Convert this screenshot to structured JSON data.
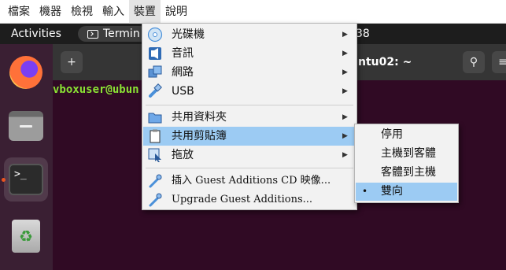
{
  "vbox_menubar": {
    "items": [
      {
        "label": "檔案",
        "active": false
      },
      {
        "label": "機器",
        "active": false
      },
      {
        "label": "檢視",
        "active": false
      },
      {
        "label": "輸入",
        "active": false
      },
      {
        "label": "裝置",
        "active": true
      },
      {
        "label": "說明",
        "active": false
      }
    ]
  },
  "ubuntu_topbar": {
    "activities": "Activities",
    "app_name": "Termin",
    "clock": "38"
  },
  "dock": {
    "items": [
      {
        "name": "firefox",
        "running": false
      },
      {
        "name": "files",
        "running": false
      },
      {
        "name": "terminal",
        "running": true
      },
      {
        "name": "trash",
        "running": false
      }
    ],
    "terminal_glyph": ">_",
    "trash_glyph": "♻"
  },
  "terminal": {
    "title": "ntu02: ~",
    "prompt": "vboxuser@ubun",
    "new_tab_glyph": "+",
    "search_glyph": "⚲",
    "menu_glyph": "≡"
  },
  "devices_menu": {
    "arrow_glyph": "▶",
    "items": [
      {
        "label": "光碟機",
        "icon": "optical-disc-icon",
        "submenu": true,
        "highlighted": false
      },
      {
        "label": "音訊",
        "icon": "audio-icon",
        "submenu": true,
        "highlighted": false
      },
      {
        "label": "網路",
        "icon": "network-icon",
        "submenu": true,
        "highlighted": false
      },
      {
        "label": "USB",
        "icon": "usb-icon",
        "submenu": true,
        "highlighted": false
      },
      {
        "label": "共用資料夾",
        "icon": "shared-folder-icon",
        "submenu": true,
        "highlighted": false
      },
      {
        "label": "共用剪貼簿",
        "icon": "shared-clipboard-icon",
        "submenu": true,
        "highlighted": true
      },
      {
        "label": "拖放",
        "icon": "drag-drop-icon",
        "submenu": true,
        "highlighted": false
      },
      {
        "label": "插入 Guest Additions CD 映像...",
        "icon": "guest-additions-icon",
        "submenu": false,
        "highlighted": false
      },
      {
        "label": "Upgrade Guest Additions...",
        "icon": "upgrade-guest-additions-icon",
        "submenu": false,
        "highlighted": false
      }
    ]
  },
  "clipboard_submenu": {
    "bullet_glyph": "•",
    "items": [
      {
        "label": "停用",
        "selected": false,
        "highlighted": false
      },
      {
        "label": "主機到客體",
        "selected": false,
        "highlighted": false
      },
      {
        "label": "客體到主機",
        "selected": false,
        "highlighted": false
      },
      {
        "label": "雙向",
        "selected": true,
        "highlighted": true
      }
    ]
  }
}
